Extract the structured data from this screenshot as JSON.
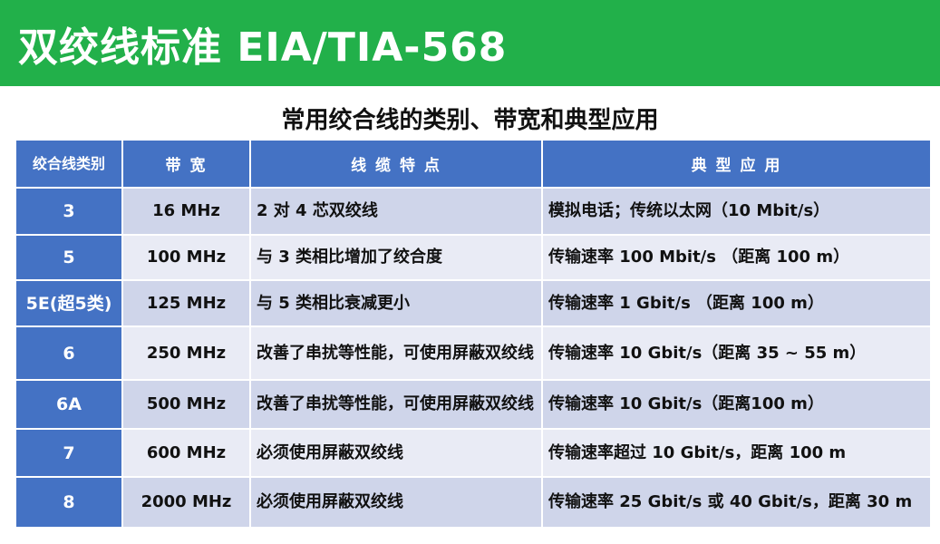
{
  "banner": {
    "title": "双绞线标准 EIA/TIA-568"
  },
  "subtitle": "常用绞合线的类别、带宽和典型应用",
  "table": {
    "headers": [
      "绞合线类别",
      "带 宽",
      "线 缆 特 点",
      "典 型 应 用"
    ],
    "rows": [
      {
        "category": "3",
        "bandwidth": "16 MHz",
        "features": "2 对 4 芯双绞线",
        "application": "模拟电话；传统以太网（10 Mbit/s）"
      },
      {
        "category": "5",
        "bandwidth": "100 MHz",
        "features": "与 3 类相比增加了绞合度",
        "application": "传输速率 100 Mbit/s （距离 100 m）"
      },
      {
        "category": "5E(超5类)",
        "bandwidth": "125 MHz",
        "features": "与 5 类相比衰减更小",
        "application": "传输速率 1 Gbit/s （距离 100 m）"
      },
      {
        "category": "6",
        "bandwidth": "250 MHz",
        "features": "改善了串扰等性能，可使用屏蔽双绞线",
        "application": "传输速率 10 Gbit/s（距离 35 ~ 55 m）"
      },
      {
        "category": "6A",
        "bandwidth": "500 MHz",
        "features": "改善了串扰等性能，可使用屏蔽双绞线",
        "application": "传输速率 10 Gbit/s（距离100 m）"
      },
      {
        "category": "7",
        "bandwidth": "600 MHz",
        "features": "必须使用屏蔽双绞线",
        "application": "传输速率超过 10 Gbit/s，距离 100 m"
      },
      {
        "category": "8",
        "bandwidth": "2000 MHz",
        "features": "必须使用屏蔽双绞线",
        "application": "传输速率 25 Gbit/s 或 40 Gbit/s，距离 30 m"
      }
    ]
  },
  "colors": {
    "banner": "#22b04a",
    "header": "#4472c4",
    "row_dark": "#cfd5ea",
    "row_light": "#e9ebf5"
  }
}
